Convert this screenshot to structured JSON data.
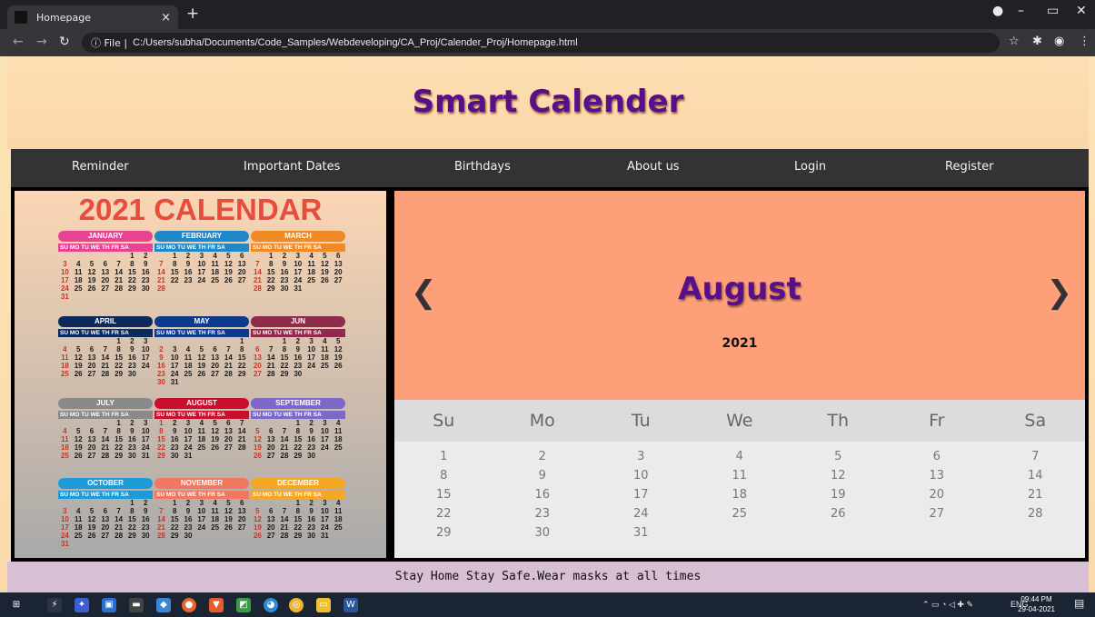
{
  "browser": {
    "tab_title": "Homepage",
    "tab_close": "×",
    "new_tab": "+",
    "address_prefix": "ⓘ File |",
    "url": "C:/Users/subha/Documents/Code_Samples/Webdeveloping/CA_Proj/Calender_Proj/Homepage.html"
  },
  "site": {
    "title": "Smart Calender",
    "nav": [
      "Reminder",
      "Important Dates",
      "Birthdays",
      "About us",
      "Login",
      "Register"
    ],
    "footer": "Stay Home Stay Safe.Wear masks at all times"
  },
  "year_calendar": {
    "title": "2021 CALENDAR",
    "weekday_header": "SU MO TU WE TH FR SA",
    "months": [
      {
        "name": "JANUARY",
        "color": "#e84393",
        "rows": [
          [
            "",
            "",
            "",
            "",
            "",
            "1",
            "2"
          ],
          [
            "3",
            "4",
            "5",
            "6",
            "7",
            "8",
            "9"
          ],
          [
            "10",
            "11",
            "12",
            "13",
            "14",
            "15",
            "16"
          ],
          [
            "17",
            "18",
            "19",
            "20",
            "21",
            "22",
            "23"
          ],
          [
            "24",
            "25",
            "26",
            "27",
            "28",
            "29",
            "30"
          ],
          [
            "31",
            "",
            "",
            "",
            "",
            "",
            ""
          ]
        ]
      },
      {
        "name": "FEBRUARY",
        "color": "#1e88c8",
        "rows": [
          [
            "",
            "1",
            "2",
            "3",
            "4",
            "5",
            "6"
          ],
          [
            "7",
            "8",
            "9",
            "10",
            "11",
            "12",
            "13"
          ],
          [
            "14",
            "15",
            "16",
            "17",
            "18",
            "19",
            "20"
          ],
          [
            "21",
            "22",
            "23",
            "24",
            "25",
            "26",
            "27"
          ],
          [
            "28",
            "",
            "",
            "",
            "",
            "",
            ""
          ]
        ]
      },
      {
        "name": "MARCH",
        "color": "#f08a24",
        "rows": [
          [
            "",
            "1",
            "2",
            "3",
            "4",
            "5",
            "6"
          ],
          [
            "7",
            "8",
            "9",
            "10",
            "11",
            "12",
            "13"
          ],
          [
            "14",
            "15",
            "16",
            "17",
            "18",
            "19",
            "20"
          ],
          [
            "21",
            "22",
            "23",
            "24",
            "25",
            "26",
            "27"
          ],
          [
            "28",
            "29",
            "30",
            "31",
            "",
            "",
            ""
          ]
        ]
      },
      {
        "name": "APRIL",
        "color": "#0d2a5c",
        "rows": [
          [
            "",
            "",
            "",
            "",
            "1",
            "2",
            "3"
          ],
          [
            "4",
            "5",
            "6",
            "7",
            "8",
            "9",
            "10"
          ],
          [
            "11",
            "12",
            "13",
            "14",
            "15",
            "16",
            "17"
          ],
          [
            "18",
            "19",
            "20",
            "21",
            "22",
            "23",
            "24"
          ],
          [
            "25",
            "26",
            "27",
            "28",
            "29",
            "30",
            ""
          ]
        ]
      },
      {
        "name": "MAY",
        "color": "#0d3a8c",
        "rows": [
          [
            "",
            "",
            "",
            "",
            "",
            "",
            "1"
          ],
          [
            "2",
            "3",
            "4",
            "5",
            "6",
            "7",
            "8"
          ],
          [
            "9",
            "10",
            "11",
            "12",
            "13",
            "14",
            "15"
          ],
          [
            "16",
            "17",
            "18",
            "19",
            "20",
            "21",
            "22"
          ],
          [
            "23",
            "24",
            "25",
            "26",
            "27",
            "28",
            "29"
          ],
          [
            "30",
            "31",
            "",
            "",
            "",
            "",
            ""
          ]
        ]
      },
      {
        "name": "JUN",
        "color": "#8e2a4a",
        "rows": [
          [
            "",
            "",
            "1",
            "2",
            "3",
            "4",
            "5"
          ],
          [
            "6",
            "7",
            "8",
            "9",
            "10",
            "11",
            "12"
          ],
          [
            "13",
            "14",
            "15",
            "16",
            "17",
            "18",
            "19"
          ],
          [
            "20",
            "21",
            "22",
            "23",
            "24",
            "25",
            "26"
          ],
          [
            "27",
            "28",
            "29",
            "30",
            "",
            "",
            ""
          ]
        ]
      },
      {
        "name": "JULY",
        "color": "#8a8a8a",
        "rows": [
          [
            "",
            "",
            "",
            "",
            "1",
            "2",
            "3"
          ],
          [
            "4",
            "5",
            "6",
            "7",
            "8",
            "9",
            "10"
          ],
          [
            "11",
            "12",
            "13",
            "14",
            "15",
            "16",
            "17"
          ],
          [
            "18",
            "19",
            "20",
            "21",
            "22",
            "23",
            "24"
          ],
          [
            "25",
            "26",
            "27",
            "28",
            "29",
            "30",
            "31"
          ]
        ]
      },
      {
        "name": "AUGUST",
        "color": "#c8102e",
        "rows": [
          [
            "1",
            "2",
            "3",
            "4",
            "5",
            "6",
            "7"
          ],
          [
            "8",
            "9",
            "10",
            "11",
            "12",
            "13",
            "14"
          ],
          [
            "15",
            "16",
            "17",
            "18",
            "19",
            "20",
            "21"
          ],
          [
            "22",
            "23",
            "24",
            "25",
            "26",
            "27",
            "28"
          ],
          [
            "29",
            "30",
            "31",
            "",
            "",
            "",
            ""
          ]
        ]
      },
      {
        "name": "SEPTEMBER",
        "color": "#7b68c8",
        "rows": [
          [
            "",
            "",
            "",
            "1",
            "2",
            "3",
            "4"
          ],
          [
            "5",
            "6",
            "7",
            "8",
            "9",
            "10",
            "11"
          ],
          [
            "12",
            "13",
            "14",
            "15",
            "16",
            "17",
            "18"
          ],
          [
            "19",
            "20",
            "21",
            "22",
            "23",
            "24",
            "25"
          ],
          [
            "26",
            "27",
            "28",
            "29",
            "30",
            "",
            ""
          ]
        ]
      },
      {
        "name": "OCTOBER",
        "color": "#1e9ad6",
        "rows": [
          [
            "",
            "",
            "",
            "",
            "",
            "1",
            "2"
          ],
          [
            "3",
            "4",
            "5",
            "6",
            "7",
            "8",
            "9"
          ],
          [
            "10",
            "11",
            "12",
            "13",
            "14",
            "15",
            "16"
          ],
          [
            "17",
            "18",
            "19",
            "20",
            "21",
            "22",
            "23"
          ],
          [
            "24",
            "25",
            "26",
            "27",
            "28",
            "29",
            "30"
          ],
          [
            "31",
            "",
            "",
            "",
            "",
            "",
            ""
          ]
        ]
      },
      {
        "name": "NOVEMBER",
        "color": "#f07860",
        "rows": [
          [
            "",
            "1",
            "2",
            "3",
            "4",
            "5",
            "6"
          ],
          [
            "7",
            "8",
            "9",
            "10",
            "11",
            "12",
            "13"
          ],
          [
            "14",
            "15",
            "16",
            "17",
            "18",
            "19",
            "20"
          ],
          [
            "21",
            "22",
            "23",
            "24",
            "25",
            "26",
            "27"
          ],
          [
            "28",
            "29",
            "30",
            "",
            "",
            "",
            ""
          ]
        ]
      },
      {
        "name": "DECEMBER",
        "color": "#f5a623",
        "rows": [
          [
            "",
            "",
            "",
            "1",
            "2",
            "3",
            "4"
          ],
          [
            "5",
            "6",
            "7",
            "8",
            "9",
            "10",
            "11"
          ],
          [
            "12",
            "13",
            "14",
            "15",
            "16",
            "17",
            "18"
          ],
          [
            "19",
            "20",
            "21",
            "22",
            "23",
            "24",
            "25"
          ],
          [
            "26",
            "27",
            "28",
            "29",
            "30",
            "31",
            ""
          ]
        ]
      }
    ]
  },
  "month_view": {
    "prev": "❮",
    "next": "❯",
    "month": "August",
    "year": "2021",
    "weekdays": [
      "Su",
      "Mo",
      "Tu",
      "We",
      "Th",
      "Fr",
      "Sa"
    ],
    "rows": [
      [
        "1",
        "2",
        "3",
        "4",
        "5",
        "6",
        "7"
      ],
      [
        "8",
        "9",
        "10",
        "11",
        "12",
        "13",
        "14"
      ],
      [
        "15",
        "16",
        "17",
        "18",
        "19",
        "20",
        "21"
      ],
      [
        "22",
        "23",
        "24",
        "25",
        "26",
        "27",
        "28"
      ],
      [
        "29",
        "30",
        "31",
        "",
        "",
        "",
        ""
      ]
    ]
  },
  "taskbar": {
    "lang": "ENG",
    "time": "09:44 PM",
    "date": "29-04-2021"
  }
}
